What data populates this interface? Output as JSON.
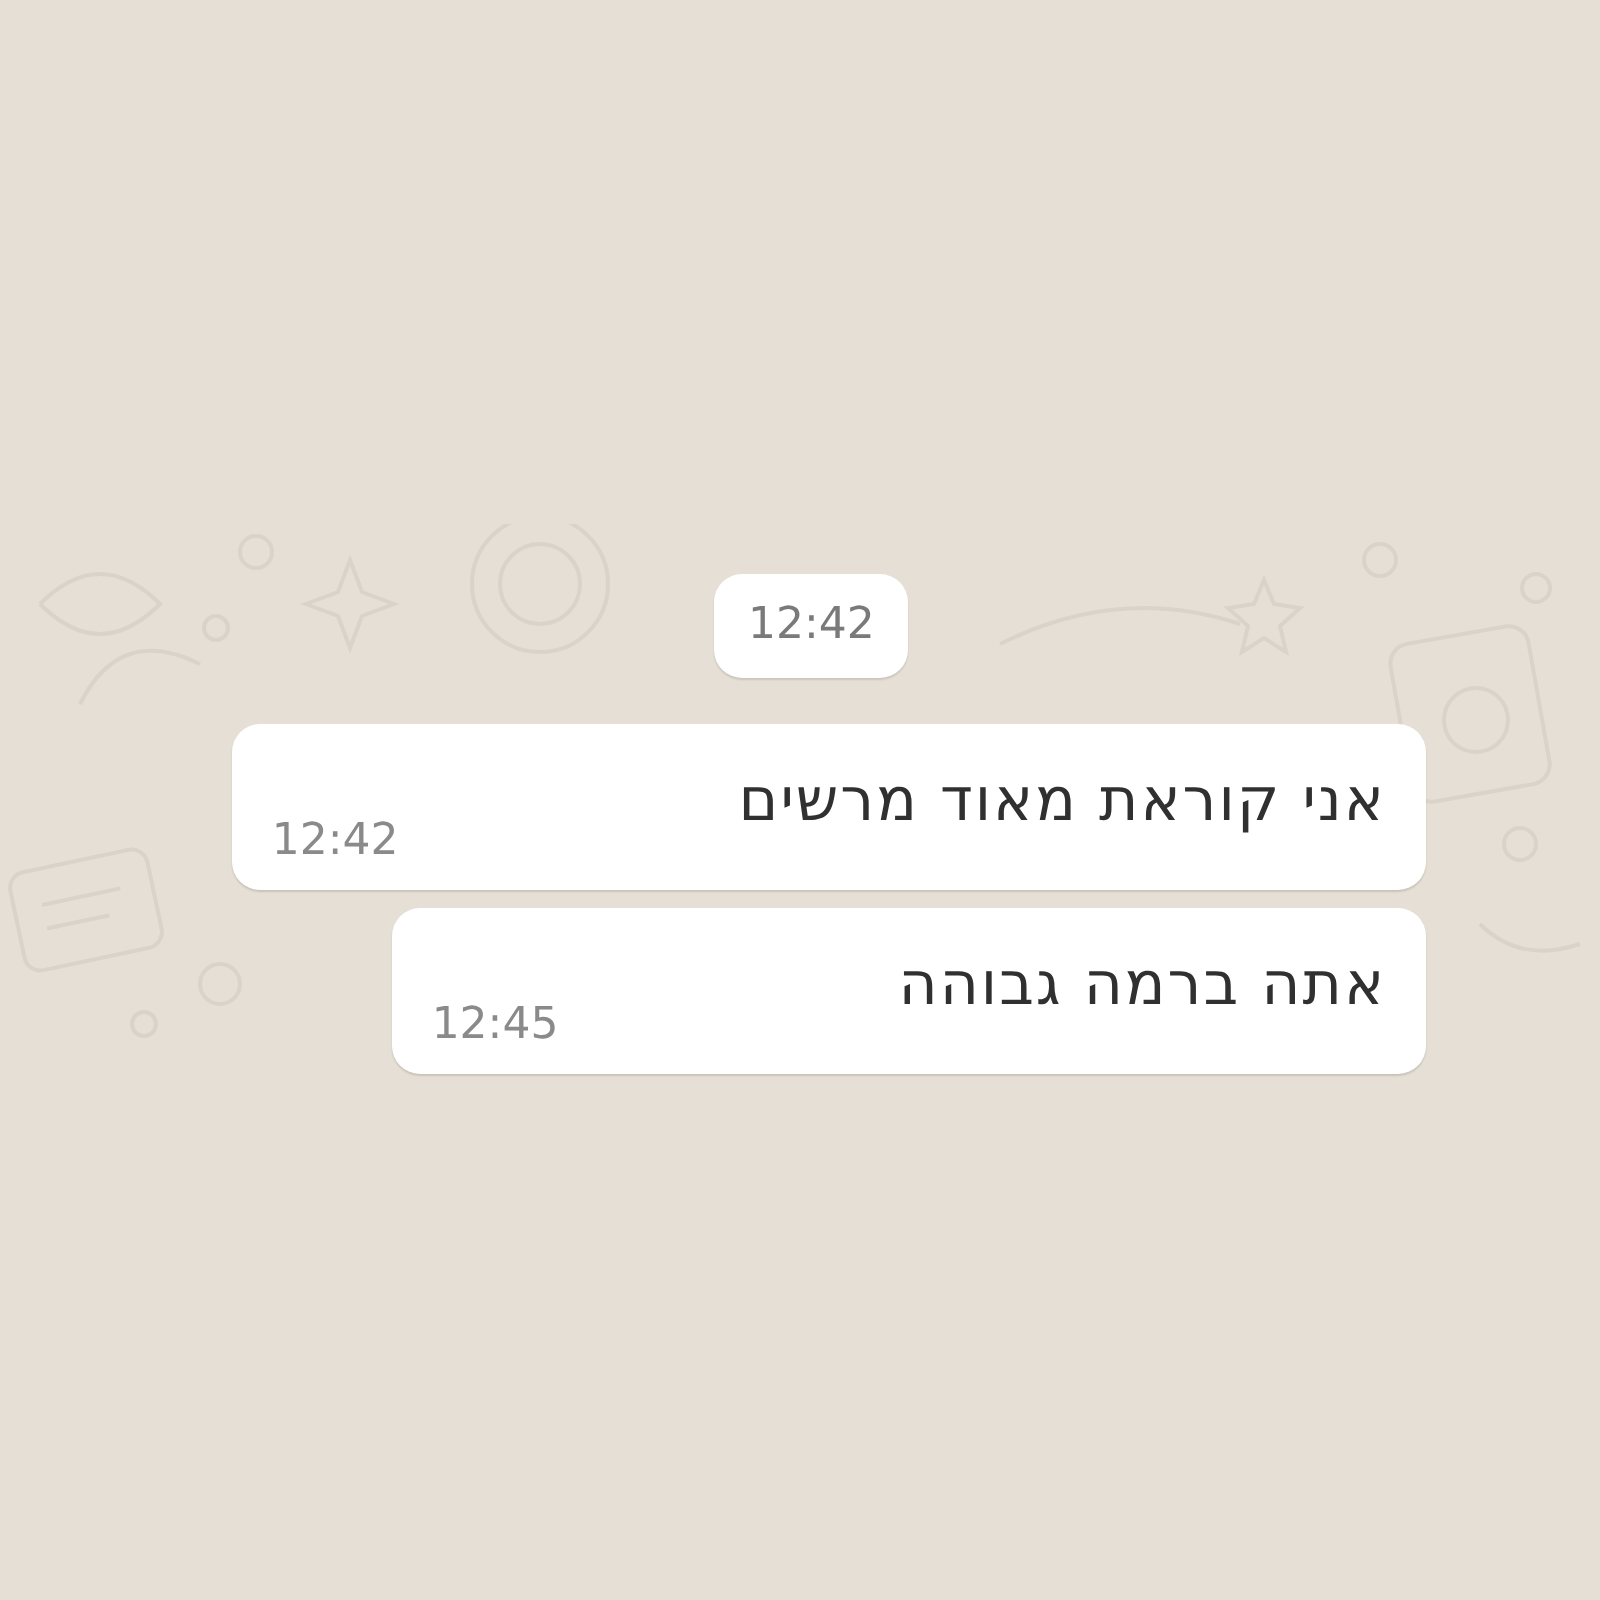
{
  "chat": {
    "date_chip": "12:42",
    "messages": [
      {
        "text": "אני קוראת מאוד מרשים",
        "time": "12:42"
      },
      {
        "text": "אתה ברמה גבוהה",
        "time": "12:45"
      }
    ]
  }
}
